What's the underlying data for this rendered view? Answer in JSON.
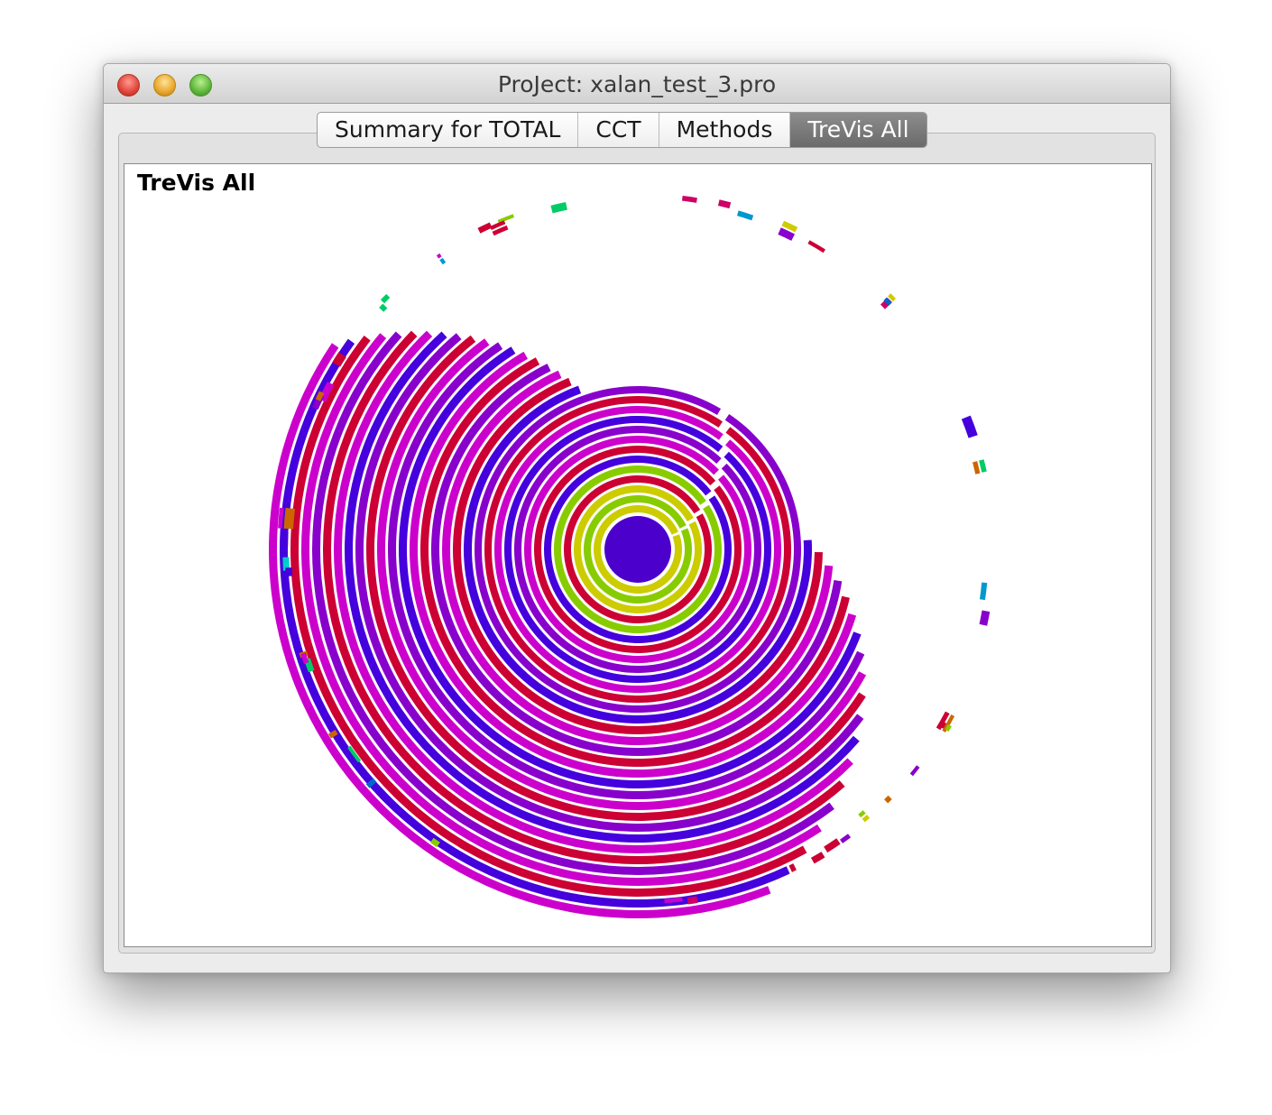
{
  "window": {
    "title": "ProJect: xalan_test_3.pro"
  },
  "tabs": [
    {
      "label": "Summary for TOTAL",
      "active": false
    },
    {
      "label": "CCT",
      "active": false
    },
    {
      "label": "Methods",
      "active": false
    },
    {
      "label": "TreVis All",
      "active": true
    }
  ],
  "panel": {
    "title": "TreVis All"
  },
  "sunburst": {
    "palette": [
      "#cc00cc",
      "#8800cc",
      "#4400dd",
      "#cc0033",
      "#88cc00",
      "#cccc00",
      "#00cccc",
      "#cc6600",
      "#00cc66",
      "#0066cc",
      "#cc0066",
      "#0099cc"
    ],
    "center_color": "#4c00cc"
  }
}
